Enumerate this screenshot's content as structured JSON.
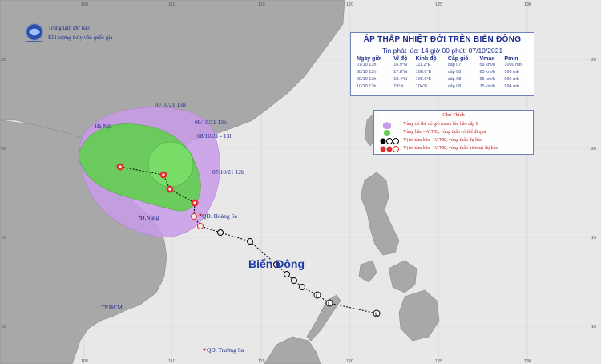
{
  "header": {
    "org_name": "Trung tâm Dự báo",
    "org_sub": "Khí tượng thủy văn quốc gia"
  },
  "title_box": {
    "title": "ÁP THẤP NHIỆT ĐỚI TRÊN BIỂN ĐÔNG",
    "issued": "Tin phát lúc: 14 giờ 00 phút, 07/10/2021",
    "columns": [
      "Ngày giờ",
      "Vĩ độ",
      "Kinh độ",
      "Cấp gió",
      "Vmax",
      "Pmin"
    ],
    "rows": [
      [
        "07/10 13h",
        "16.9°N",
        "111.2°E",
        "cấp 07",
        "56 km/h",
        "1000 mb"
      ],
      [
        "08/10 13h",
        "17.8°N",
        "108.0°E",
        "cấp 08",
        "65 km/h",
        "996 mb"
      ],
      [
        "09/10 13h",
        "18.4°N",
        "106.9°E",
        "cấp 08",
        "65 km/h",
        "996 mb"
      ],
      [
        "10/10 13h",
        "19°N",
        "104°E",
        "cấp 08",
        "75 km/h",
        "994 mb"
      ]
    ]
  },
  "legend": {
    "title": "Chú Thích",
    "items": [
      {
        "label": "Vùng có thể có gió mạnh lúc bão cấp 8",
        "color": "#c99be8"
      },
      {
        "label": "Vùng bão - ATNĐ, vùng thấp có thể đi qua",
        "color": "#66cc55"
      },
      {
        "label": "Vị trí tâm bão - ATNĐ, vùng thấp dự báo",
        "color": "#000000"
      },
      {
        "label": "Vị trí tâm bão - ATNĐ, vùng thấp hiện tại dự báo",
        "color": "#e03030"
      }
    ]
  },
  "map_labels": {
    "date_1": "10/10/21 13h",
    "date_2": "09/10/21 13h",
    "date_3": "08/10/21 - 13h",
    "date_4": "07/10/21 12h",
    "hanoi": "Hà Nội",
    "danang": "Đ.Nẵng",
    "hoangsa": "QĐ. Hoàng Sa",
    "biendong": "Biển Đông",
    "tphcm": "TP.HCM",
    "truongsa": "QĐ. Trường Sa"
  },
  "axis": {
    "top": [
      "105",
      "110",
      "115",
      "120",
      "125",
      "130"
    ],
    "bottom": [
      "105",
      "110",
      "115",
      "120",
      "125",
      "130"
    ],
    "left": [
      "25",
      "20",
      "15",
      "10"
    ],
    "right": [
      "25",
      "20",
      "15",
      "10"
    ]
  },
  "colors": {
    "sea": "#e8e8e8",
    "land": "#a8a8a8",
    "windzone": "#c99be8",
    "stormzone": "#66cc55",
    "current": "#e03030",
    "text_blue": "#1c2a8c"
  }
}
